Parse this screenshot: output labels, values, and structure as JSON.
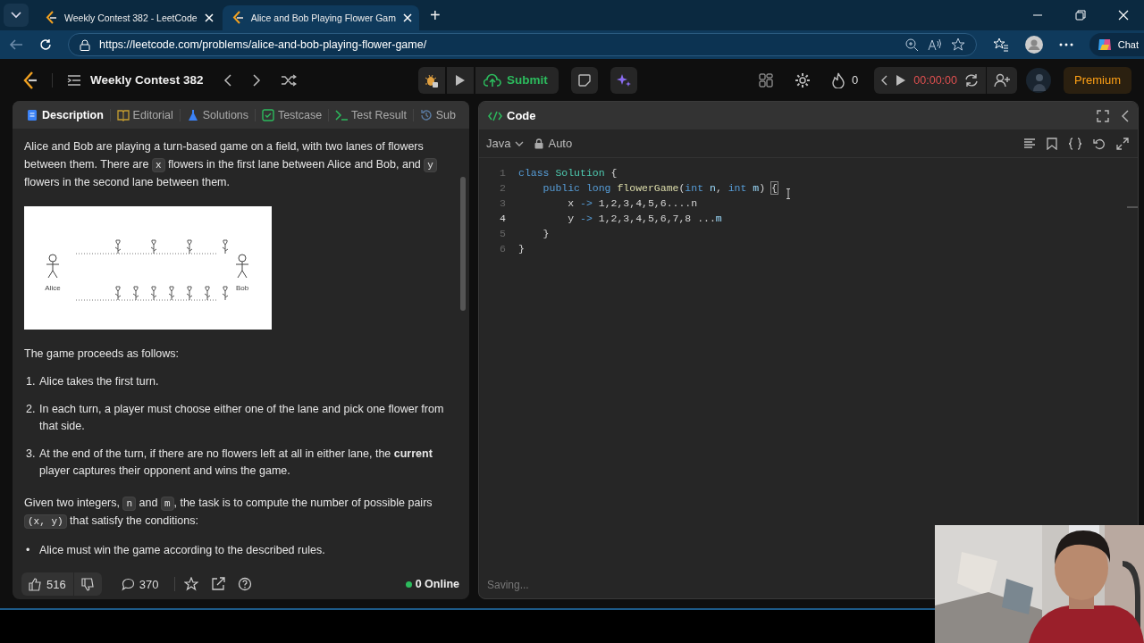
{
  "browser": {
    "tabs": [
      {
        "title": "Weekly Contest 382 - LeetCode",
        "selected": false
      },
      {
        "title": "Alice and Bob Playing Flower Gam",
        "selected": true
      }
    ],
    "new_tab": "+",
    "url": "https://leetcode.com/problems/alice-and-bob-playing-flower-game/",
    "chat": "Chat"
  },
  "app": {
    "contest_title": "Weekly Contest 382",
    "submit": "Submit",
    "streak": "0",
    "timer": "00:00:00",
    "premium": "Premium"
  },
  "left_tabs": [
    {
      "label": "Description",
      "kind": "description",
      "selected": true
    },
    {
      "label": "Editorial",
      "kind": "editorial",
      "selected": false
    },
    {
      "label": "Solutions",
      "kind": "solutions",
      "selected": false
    },
    {
      "label": "Testcase",
      "kind": "testcase",
      "selected": false
    },
    {
      "label": "Test Result",
      "kind": "result",
      "selected": false
    },
    {
      "label": "Sub",
      "kind": "submissions",
      "selected": false
    }
  ],
  "description": [
    {
      "kind": "para",
      "segments": [
        {
          "kind": "text",
          "text": "Alice and Bob are playing a turn-based game on a field, with two lanes of flowers between them. There are "
        },
        {
          "kind": "code",
          "text": "x"
        },
        {
          "kind": "text",
          "text": " flowers in the first lane between Alice and Bob, and "
        },
        {
          "kind": "code",
          "text": "y"
        },
        {
          "kind": "text",
          "text": " flowers in the second lane between them."
        }
      ]
    },
    {
      "kind": "diagram",
      "left_label": "Alice",
      "right_label": "Bob"
    },
    {
      "kind": "para",
      "segments": [
        {
          "kind": "text",
          "text": "The game proceeds as follows:"
        }
      ]
    },
    {
      "kind": "ol",
      "items": [
        {
          "marker": "1.",
          "text": "Alice takes the first turn."
        },
        {
          "marker": "2.",
          "text": "In each turn, a player must choose either one of the lane and pick one flower from that side."
        },
        {
          "marker": "3.",
          "text": "At the end of the turn, if there are no flowers left at all in either lane, the **current** player captures their opponent and wins the game."
        }
      ]
    },
    {
      "kind": "para",
      "segments": [
        {
          "kind": "text",
          "text": "Given two integers, "
        },
        {
          "kind": "code",
          "text": "n"
        },
        {
          "kind": "text",
          "text": " and "
        },
        {
          "kind": "code",
          "text": "m"
        },
        {
          "kind": "text",
          "text": ", the task is to compute the number of possible pairs "
        },
        {
          "kind": "code",
          "text": "(x, y)"
        },
        {
          "kind": "text",
          "text": " that satisfy the conditions:"
        }
      ]
    },
    {
      "kind": "ul",
      "items": [
        {
          "marker": "•",
          "text": "Alice must win the game according to the described rules."
        }
      ]
    }
  ],
  "footer": {
    "likes": "516",
    "comments": "370",
    "online": "0 Online"
  },
  "code": {
    "title": "Code",
    "language": "Java",
    "mode": "Auto",
    "status": "Saving...",
    "lines": [
      {
        "number": "1",
        "current": false,
        "tokens": [
          {
            "kind": "kw",
            "text": "class"
          },
          {
            "kind": "type",
            "text": " Solution"
          },
          {
            "kind": "plain",
            "text": " {"
          }
        ]
      },
      {
        "number": "2",
        "current": false,
        "tokens": [
          {
            "kind": "kw",
            "text": "    public"
          },
          {
            "kind": "kw",
            "text": " long"
          },
          {
            "kind": "fn",
            "text": " flowerGame"
          },
          {
            "kind": "plain",
            "text": "("
          },
          {
            "kind": "kw",
            "text": "int"
          },
          {
            "kind": "var",
            "text": " n"
          },
          {
            "kind": "plain",
            "text": ", "
          },
          {
            "kind": "kw",
            "text": "int"
          },
          {
            "kind": "var",
            "text": " m"
          },
          {
            "kind": "plain",
            "text": ") "
          },
          {
            "kind": "bracket",
            "text": "{"
          }
        ]
      },
      {
        "number": "3",
        "current": false,
        "tokens": [
          {
            "kind": "plain",
            "text": "        x "
          },
          {
            "kind": "op",
            "text": "->"
          },
          {
            "kind": "num",
            "text": " 1,2,3,4,5,6....n"
          }
        ]
      },
      {
        "number": "4",
        "current": true,
        "tokens": [
          {
            "kind": "plain",
            "text": "        y "
          },
          {
            "kind": "op",
            "text": "->"
          },
          {
            "kind": "num",
            "text": " 1,2,3,4,5,6,7,8 ..."
          },
          {
            "kind": "var",
            "text": "m"
          }
        ]
      },
      {
        "number": "5",
        "current": false,
        "tokens": [
          {
            "kind": "plain",
            "text": "    }"
          }
        ]
      },
      {
        "number": "6",
        "current": false,
        "tokens": [
          {
            "kind": "plain",
            "text": "}"
          }
        ]
      }
    ]
  }
}
